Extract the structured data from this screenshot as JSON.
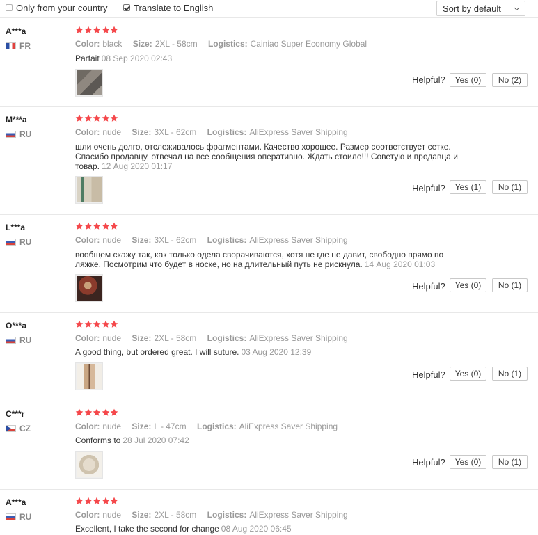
{
  "filters": {
    "only_country_label": "Only from your country",
    "translate_label": "Translate to English",
    "only_country_checked": false,
    "translate_checked": true,
    "sort_label": "Sort by default"
  },
  "helpful_label": "Helpful?",
  "labels": {
    "color": "Color:",
    "size": "Size:",
    "logistics": "Logistics:"
  },
  "star_color": "#f5484b",
  "reviews": [
    {
      "user": "A***a",
      "country": "FR",
      "flag": "fr",
      "stars": 5,
      "star_label": "5 stars",
      "color": "black",
      "size": "2XL - 58cm",
      "logistics": "Cainiao Super Economy Global",
      "text": "Parfait",
      "date": "08 Sep 2020 02:43",
      "yes": "Yes (0)",
      "no": "No (2)",
      "photo": "product-photo"
    },
    {
      "user": "M***a",
      "country": "RU",
      "flag": "ru",
      "stars": 5,
      "star_label": "5 stars",
      "color": "nude",
      "size": "3XL - 62cm",
      "logistics": "AliExpress Saver Shipping",
      "text": "шли очень долго, отслеживалось фрагментами. Качество хорошее. Размер соответствует сетке. Спасибо продавцу, отвечал на все сообщения оперативно. Ждать стоило!!! Советую и продавца и товар.",
      "date": "12 Aug 2020 01:17",
      "yes": "Yes (1)",
      "no": "No (1)",
      "photo": "product-photo"
    },
    {
      "user": "L***a",
      "country": "RU",
      "flag": "ru",
      "stars": 5,
      "star_label": "5 stars",
      "color": "nude",
      "size": "3XL - 62cm",
      "logistics": "AliExpress Saver Shipping",
      "text": "вообщем скажу так, как только одела сворачиваются, хотя не где не давит, свободно прямо по ляжке. Посмотрим что будет в носке, но на длительный путь не рискнула.",
      "date": "14 Aug 2020 01:03",
      "yes": "Yes (0)",
      "no": "No (1)",
      "photo": "product-photo"
    },
    {
      "user": "O***a",
      "country": "RU",
      "flag": "ru",
      "stars": 5,
      "star_label": "5 stars",
      "color": "nude",
      "size": "2XL - 58cm",
      "logistics": "AliExpress Saver Shipping",
      "text": "A good thing, but ordered great. I will suture.",
      "date": "03 Aug 2020 12:39",
      "yes": "Yes (0)",
      "no": "No (1)",
      "photo": "product-photo"
    },
    {
      "user": "C***r",
      "country": "CZ",
      "flag": "cz",
      "stars": 5,
      "star_label": "5 stars",
      "color": "nude",
      "size": "L - 47cm",
      "logistics": "AliExpress Saver Shipping",
      "text": "Conforms to",
      "date": "28 Jul 2020 07:42",
      "yes": "Yes (0)",
      "no": "No (1)",
      "photo": "product-photo"
    },
    {
      "user": "A***a",
      "country": "RU",
      "flag": "ru",
      "stars": 5,
      "star_label": "5 stars",
      "color": "nude",
      "size": "2XL - 58cm",
      "logistics": "AliExpress Saver Shipping",
      "text": "Excellent, I take the second for change",
      "date": "08 Aug 2020 06:45",
      "yes": "",
      "no": "",
      "photo": ""
    }
  ]
}
